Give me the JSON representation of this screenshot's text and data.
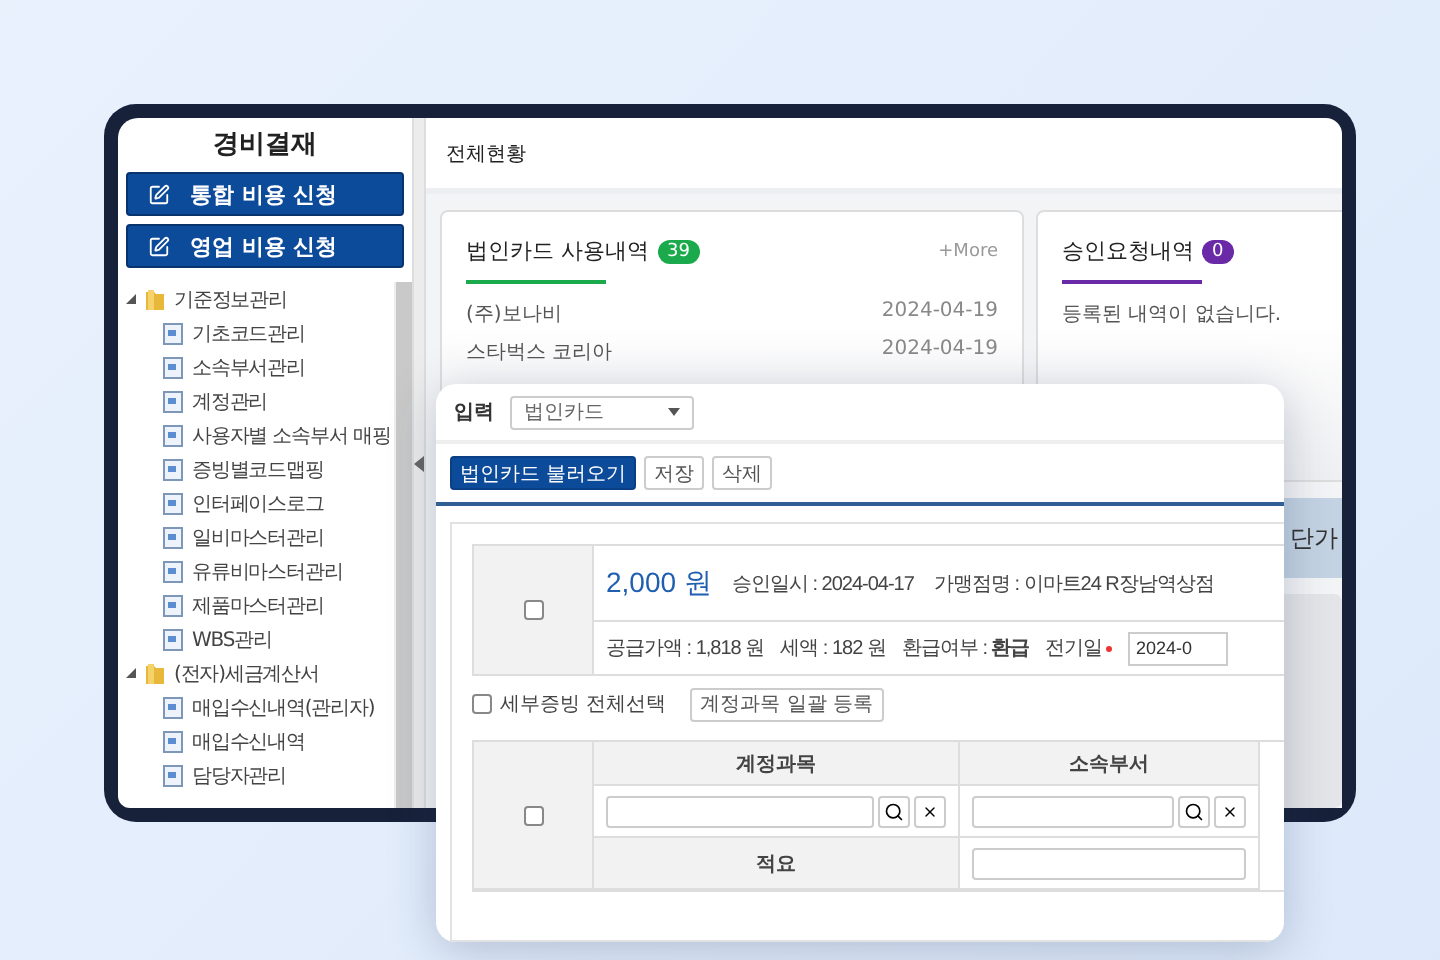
{
  "sidebar": {
    "title": "경비결재",
    "buttons": [
      "통합 비용 신청",
      "영업 비용 신청"
    ],
    "tree": [
      {
        "label": "기준정보관리",
        "expanded": true,
        "children": [
          {
            "label": "기초코드관리"
          },
          {
            "label": "소속부서관리"
          },
          {
            "label": "계정관리"
          },
          {
            "label": "사용자별 소속부서 매핑"
          },
          {
            "label": "증빙별코드맵핑"
          },
          {
            "label": "인터페이스로그"
          },
          {
            "label": "일비마스터관리"
          },
          {
            "label": "유류비마스터관리"
          },
          {
            "label": "제품마스터관리"
          },
          {
            "label": "WBS관리"
          }
        ]
      },
      {
        "label": "(전자)세금계산서",
        "expanded": true,
        "children": [
          {
            "label": "매입수신내역(관리자)"
          },
          {
            "label": "매입수신내역"
          },
          {
            "label": "담당자관리"
          }
        ]
      }
    ]
  },
  "main": {
    "title": "전체현황",
    "cards": [
      {
        "title": "법인카드 사용내역",
        "count": "39",
        "color": "#1aaa4b",
        "more": "+More",
        "rows": [
          {
            "name": "(주)보나비",
            "date": "2024-04-19"
          },
          {
            "name": "스타벅스 코리아",
            "date": "2024-04-19"
          }
        ]
      },
      {
        "title": "승인요청내역",
        "count": "0",
        "color": "#6a2aa8",
        "empty": "등록된 내역이 없습니다."
      }
    ],
    "banner": "단가"
  },
  "dialog": {
    "input_label": "입력",
    "input_type": "법인카드",
    "buttons": [
      {
        "label": "법인카드 불러오기",
        "primary": true
      },
      {
        "label": "저장",
        "primary": false
      },
      {
        "label": "삭제",
        "primary": false
      }
    ],
    "transaction": {
      "checked": false,
      "amount": "2,000 원",
      "approved_at": "승인일시 : 2024-04-17",
      "merchant": "가맹점명 : 이마트24 R장남역상점",
      "supply": "공급가액 : 1,818 원",
      "tax": "세액 : 182 원",
      "refund": "환급여부 : **환급**",
      "posting_label": "전기일",
      "posting_required": true,
      "posting_date": "2024-0"
    },
    "select_all": {
      "label": "세부증빙 전체선택",
      "checked": false
    },
    "bulk_button": "계정과목 일괄 등록",
    "detail": {
      "checked": false,
      "columns": [
        "계정과목",
        "소속부서"
      ],
      "memo_label": "적요"
    }
  }
}
